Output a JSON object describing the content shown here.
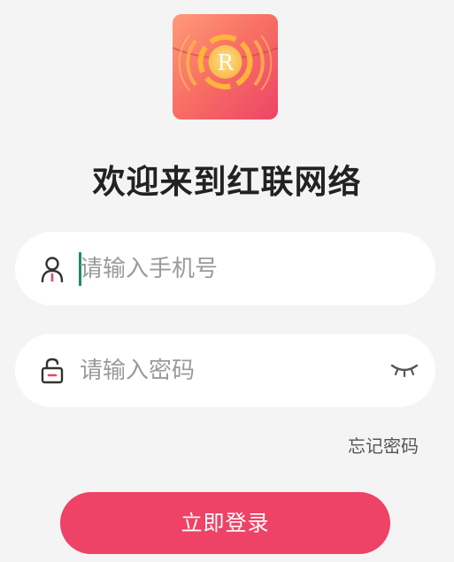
{
  "logo": {
    "letter": "R",
    "icon": "app-logo-coin",
    "bg_start": "#ff9a7a",
    "bg_end": "#ee4466"
  },
  "title": "欢迎来到红联网络",
  "phone_field": {
    "icon": "user-icon",
    "placeholder": "请输入手机号"
  },
  "password_field": {
    "icon": "lock-open-icon",
    "placeholder": "请输入密码",
    "toggle_icon": "eye-closed-icon"
  },
  "forgot_password": "忘记密码",
  "login_button": "立即登录",
  "colors": {
    "accent": "#ee4266",
    "caret": "#1f8a6d",
    "background": "#f4f4f4"
  }
}
